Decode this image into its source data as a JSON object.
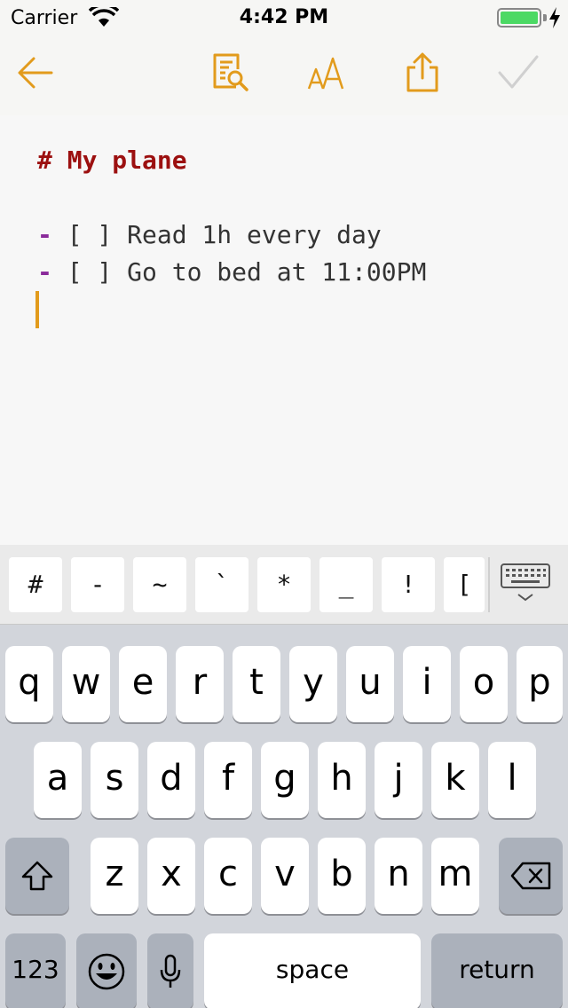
{
  "status_bar": {
    "carrier": "Carrier",
    "time": "4:42 PM",
    "battery_level": 1.0
  },
  "toolbar": {
    "back_icon": "arrow-left-icon",
    "find_icon": "document-search-icon",
    "font_icon": "font-size-icon",
    "share_icon": "share-icon",
    "done_icon": "checkmark-icon",
    "accent_color": "#e29b1c",
    "disabled_color": "#d0d0d0"
  },
  "editor": {
    "heading": "# My plane",
    "todos": [
      {
        "dash": "-",
        "text": " [ ] Read 1h every day"
      },
      {
        "dash": "-",
        "text": " [ ] Go to bed at 11:00PM"
      }
    ],
    "heading_color": "#9c1010",
    "dash_color": "#8a2a9a",
    "cursor_color": "#e29b1c"
  },
  "accessory_bar": {
    "keys": [
      "#",
      "-",
      "~",
      "`",
      "*",
      "_",
      "!",
      "["
    ],
    "dismiss_icon": "keyboard-dismiss-icon"
  },
  "keyboard": {
    "row1": [
      "q",
      "w",
      "e",
      "r",
      "t",
      "y",
      "u",
      "i",
      "o",
      "p"
    ],
    "row2": [
      "a",
      "s",
      "d",
      "f",
      "g",
      "h",
      "j",
      "k",
      "l"
    ],
    "row3": [
      "z",
      "x",
      "c",
      "v",
      "b",
      "n",
      "m"
    ],
    "numbers_label": "123",
    "space_label": "space",
    "return_label": "return",
    "shift_icon": "shift-icon",
    "delete_icon": "delete-icon",
    "emoji_icon": "emoji-icon",
    "mic_icon": "microphone-icon"
  }
}
